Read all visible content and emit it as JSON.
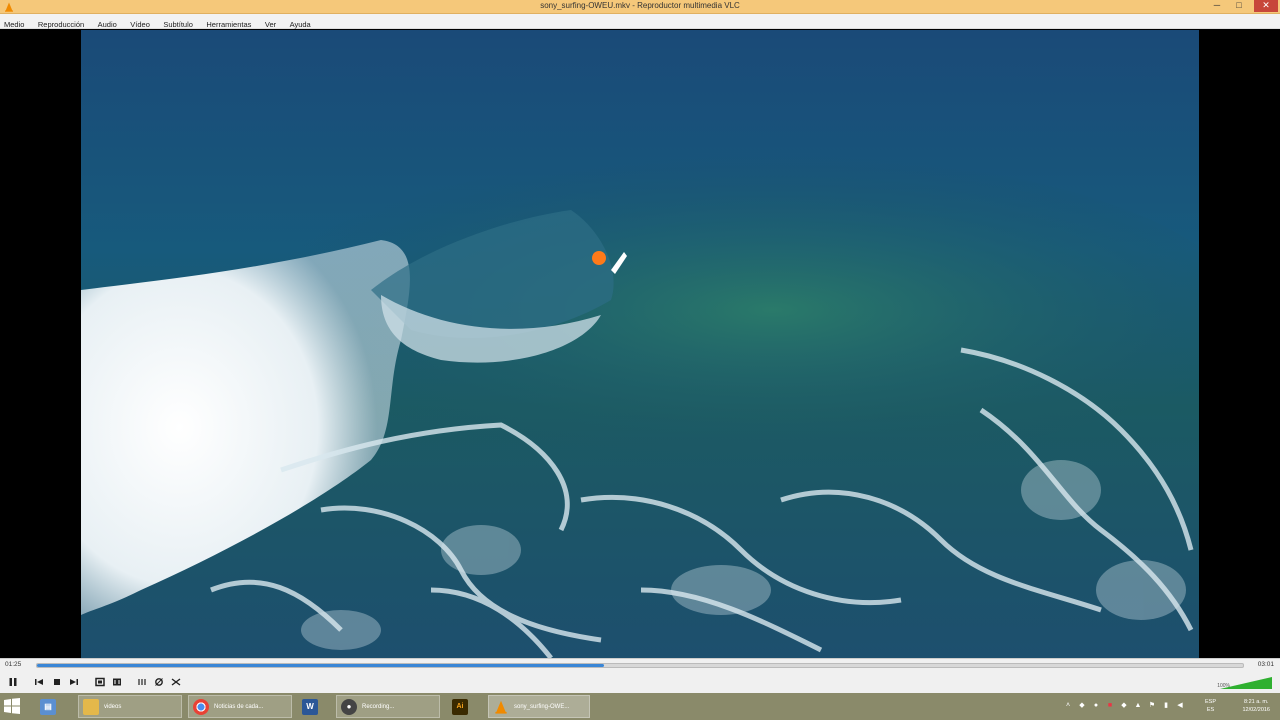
{
  "window": {
    "title": "sony_surfing-OWEU.mkv - Reproductor multimedia VLC",
    "minimize_label": "─",
    "maximize_label": "□",
    "close_label": "✕"
  },
  "menu": {
    "items": [
      "Medio",
      "Reproducción",
      "Audio",
      "Vídeo",
      "Subtítulo",
      "Herramientas",
      "Ver",
      "Ayuda"
    ]
  },
  "player": {
    "time_elapsed": "01:25",
    "time_total": "03:01",
    "progress_fraction": 0.47,
    "volume_percent": "100%",
    "volume_level": 1.0,
    "accent_color": "#3a86d6"
  },
  "controls": {
    "play_pause_icon": "pause-icon",
    "buttons": [
      "previous-icon",
      "stop-icon",
      "next-icon",
      "fullscreen-icon",
      "extended-settings-icon",
      "playlist-icon",
      "frame-icon",
      "loop-icon",
      "shuffle-icon"
    ]
  },
  "taskbar": {
    "items": [
      {
        "label": "",
        "icon": "file-explorer-icon",
        "color": "#5b8fd1"
      },
      {
        "label": "videos",
        "icon": "folder-icon",
        "color": "#e4b84a"
      },
      {
        "label": "Noticias de cada...",
        "icon": "chrome-icon",
        "color": "#ffffff"
      },
      {
        "label": "",
        "icon": "word-icon",
        "color": "#2b5797"
      },
      {
        "label": "Recording...",
        "icon": "recorder-icon",
        "color": "#444444"
      },
      {
        "label": "",
        "icon": "illustrator-icon",
        "color": "#3a2a00"
      },
      {
        "label": "sony_surfing-OWE...",
        "icon": "vlc-icon",
        "color": "#f08a00"
      }
    ],
    "language": "ESP",
    "language_sub": "ES",
    "time": "8:21 a. m.",
    "date": "12/02/2016"
  }
}
